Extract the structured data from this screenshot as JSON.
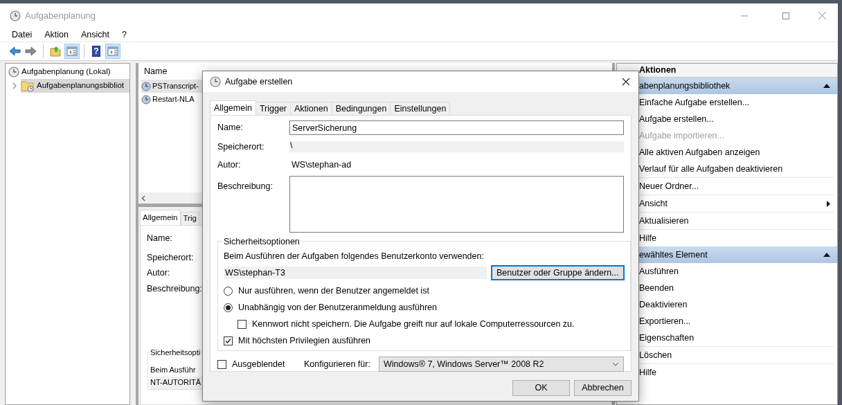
{
  "window": {
    "title": "Aufgabenplanung"
  },
  "menu": [
    "Datei",
    "Aktion",
    "Ansicht",
    "?"
  ],
  "toolbar": [
    {
      "kind": "back",
      "pressed": false
    },
    {
      "kind": "forward",
      "pressed": false
    },
    {
      "kind": "up",
      "pressed": false
    },
    {
      "kind": "tree",
      "pressed": true
    },
    {
      "kind": "help",
      "pressed": false,
      "label": "?"
    },
    {
      "kind": "actions",
      "pressed": true
    }
  ],
  "tree": [
    {
      "label": "Aufgabenplanung (Lokal)",
      "selected": false,
      "children": [
        {
          "label": "Aufgabenplanungsbibliot",
          "selected": true,
          "expanded": false
        }
      ]
    }
  ],
  "task_list": {
    "columns": [
      "Name"
    ],
    "rows": [
      {
        "name": "PSTranscript-",
        "selected": true
      },
      {
        "name": "Restart-NLA",
        "selected": false
      }
    ]
  },
  "details": {
    "tabs": [
      {
        "label": "Allgemein",
        "selected": true
      },
      {
        "label": "Trig",
        "selected": false
      }
    ],
    "labels": [
      "Name:",
      "Speicherort:",
      "Autor:",
      "Beschreibung:"
    ],
    "security": {
      "title": "Sicherheitsopti",
      "account_prompt": "Beim Ausführ",
      "account": "NT-AUTORITÄ"
    }
  },
  "actions": {
    "title": "Aktionen",
    "groups": [
      {
        "title": "abenplanungsbibliothek",
        "expanded": true,
        "sections": [
          [
            {
              "label": "Einfache Aufgabe erstellen...",
              "kind": "action",
              "disabled": false
            },
            {
              "label": "Aufgabe erstellen...",
              "kind": "action",
              "disabled": false
            },
            {
              "label": "Aufgabe importieren...",
              "kind": "action",
              "disabled": true
            },
            {
              "label": "Alle aktiven Aufgaben anzeigen",
              "kind": "action",
              "disabled": false
            },
            {
              "label": "Verlauf für alle Aufgaben deaktivieren",
              "kind": "action",
              "disabled": false
            }
          ],
          [
            {
              "label": "Neuer Ordner...",
              "kind": "action",
              "disabled": false
            }
          ],
          [
            {
              "label": "Ansicht",
              "kind": "submenu",
              "disabled": false
            }
          ],
          [
            {
              "label": "Aktualisieren",
              "kind": "action",
              "disabled": false
            }
          ],
          [
            {
              "label": "Hilfe",
              "kind": "action",
              "disabled": false
            }
          ]
        ]
      },
      {
        "title": "ewähltes Element",
        "expanded": true,
        "sections": [
          [
            {
              "label": "Ausführen",
              "kind": "action",
              "disabled": false
            },
            {
              "label": "Beenden",
              "kind": "action",
              "disabled": false
            },
            {
              "label": "Deaktivieren",
              "kind": "action",
              "disabled": false
            },
            {
              "label": "Exportieren...",
              "kind": "action",
              "disabled": false
            },
            {
              "label": "Eigenschaften",
              "kind": "action",
              "disabled": false
            }
          ],
          [
            {
              "label": "Löschen",
              "kind": "action",
              "disabled": false
            }
          ],
          [
            {
              "label": "Hilfe",
              "kind": "action",
              "disabled": false
            }
          ]
        ]
      }
    ]
  },
  "dialog": {
    "title": "Aufgabe erstellen",
    "tabs": [
      {
        "label": "Allgemein",
        "selected": true
      },
      {
        "label": "Trigger",
        "selected": false
      },
      {
        "label": "Aktionen",
        "selected": false
      },
      {
        "label": "Bedingungen",
        "selected": false
      },
      {
        "label": "Einstellungen",
        "selected": false
      }
    ],
    "name_label": "Name:",
    "name": "ServerSicherung",
    "location_label": "Speicherort:",
    "location": "\\",
    "author_label": "Autor:",
    "author": "WS\\stephan-ad",
    "description_label": "Beschreibung:",
    "security": {
      "title": "Sicherheitsoptionen",
      "account_prompt": "Beim Ausführen der Aufgaben folgendes Benutzerkonto verwenden:",
      "account": "WS\\stephan-T3",
      "change_button": "Benutzer oder Gruppe ändern...",
      "options": [
        {
          "kind": "radio",
          "label": "Nur ausführen, wenn der Benutzer angemeldet ist",
          "selected": false
        },
        {
          "kind": "radio",
          "label": "Unabhängig von der Benutzeranmeldung ausführen",
          "selected": true,
          "children": [
            {
              "kind": "checkbox",
              "label": "Kennwort nicht speichern. Die Aufgabe greift nur auf lokale Computerressourcen zu.",
              "checked": false
            }
          ]
        },
        {
          "kind": "checkbox",
          "label": "Mit höchsten Privilegien ausführen",
          "checked": true
        }
      ]
    },
    "hidden": {
      "label": "Ausgeblendet",
      "checked": false
    },
    "configure": {
      "label": "Konfigurieren für:",
      "value": "Windows® 7, Windows Server™ 2008 R2"
    },
    "buttons": [
      "OK",
      "Abbrechen"
    ]
  }
}
